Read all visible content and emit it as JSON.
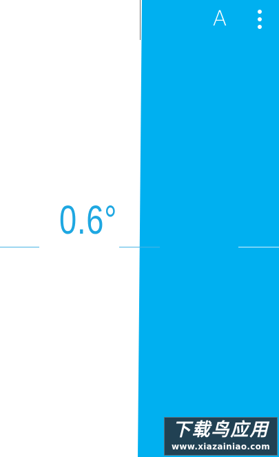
{
  "level": {
    "angle_degrees": 0.6,
    "angle_text": "0.6°",
    "colors": {
      "accent": "#00b0f0",
      "readout": "#1ea7e1",
      "background": "#ffffff"
    }
  },
  "toolbar": {
    "mode_label": "A",
    "menu_icon": "overflow-menu-icon"
  },
  "watermark": {
    "title": "下载鸟应用",
    "url": "www.xiazainiao.com"
  }
}
